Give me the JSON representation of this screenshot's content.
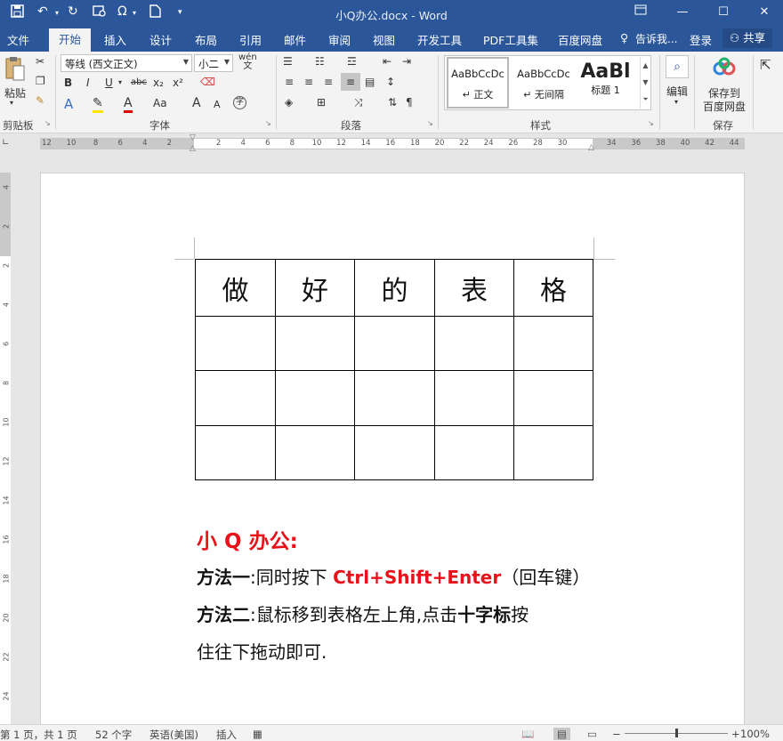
{
  "window": {
    "title": "小Q办公.docx - Word",
    "controls": {
      "restore_icon": "ribbon-display-icon",
      "minimize": "—",
      "maximize": "☐",
      "close": "✕"
    }
  },
  "quick_access": {
    "icons": [
      "save-icon",
      "undo-icon",
      "redo-icon",
      "print-preview-icon",
      "symbol-icon",
      "new-document-icon",
      "customize-icon"
    ],
    "symbol_glyph": "Ω"
  },
  "tabs": [
    "文件",
    "开始",
    "插入",
    "设计",
    "布局",
    "引用",
    "邮件",
    "审阅",
    "视图",
    "开发工具",
    "PDF工具集",
    "百度网盘"
  ],
  "active_tab": "开始",
  "tell_me": "告诉我...",
  "login": "登录",
  "share": "共享",
  "ribbon": {
    "clipboard": {
      "paste": "粘贴",
      "label": "剪贴板"
    },
    "font": {
      "name": "等线 (西文正文)",
      "size": "小二",
      "label": "字体",
      "row2": [
        "B",
        "I",
        "U",
        "abc",
        "x₂",
        "x²"
      ],
      "row3": [
        "A",
        "A",
        "Aa",
        "A",
        "A"
      ]
    },
    "paragraph": {
      "label": "段落"
    },
    "styles": {
      "label": "样式",
      "items": [
        {
          "preview": "AaBbCcDc",
          "name": "↵ 正文"
        },
        {
          "preview": "AaBbCcDc",
          "name": "↵ 无间隔"
        },
        {
          "preview": "AaBl",
          "name": "标题 1"
        }
      ]
    },
    "editing": {
      "label": "编辑"
    },
    "save": {
      "line1": "保存到",
      "line2": "百度网盘",
      "label": "保存"
    }
  },
  "ruler": {
    "left_numbers": [
      "12",
      "10",
      "8",
      "6",
      "4",
      "2"
    ],
    "right_numbers": [
      "2",
      "4",
      "6",
      "8",
      "10",
      "12",
      "14",
      "16",
      "18",
      "20",
      "22",
      "24",
      "26",
      "28",
      "30",
      "34",
      "36",
      "38",
      "40",
      "42",
      "44"
    ],
    "vertical_numbers": [
      "4",
      "2",
      "2",
      "4",
      "6",
      "8",
      "10",
      "12",
      "14",
      "16",
      "18",
      "20",
      "22",
      "24"
    ]
  },
  "document": {
    "table_header": [
      "做",
      "好",
      "的",
      "表",
      "格"
    ],
    "table_rows": 3,
    "heading": "小 Q 办公:",
    "method1": {
      "label": "方法一",
      "text_a": ":同时按下 ",
      "keys": "Ctrl+Shift+Enter",
      "text_b": "（回车键）"
    },
    "method2": {
      "label": "方法二",
      "text_a": ":鼠标移到表格左上角,点击",
      "emph": "十字标",
      "text_b": "按"
    },
    "method2_line2": "住往下拖动即可."
  },
  "status": {
    "page": "第 1 页，共 1 页",
    "words": "52 个字",
    "language": "英语(美国)",
    "mode": "插入",
    "zoom": "100%",
    "zoom_level": 100
  }
}
